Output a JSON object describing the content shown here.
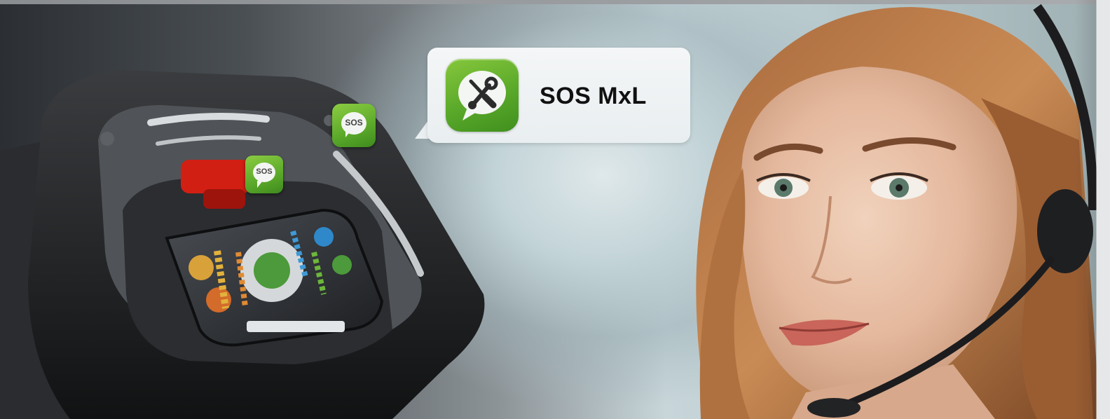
{
  "banner": {
    "bubble_title": "SOS MxL",
    "app_icon": "wrench-screwdriver-chat-icon",
    "badge_label": "SOS",
    "badge_icon": "sos-chat-icon",
    "colors": {
      "accent_green": "#5aa92a",
      "bubble_bg": "#eef2f3",
      "title_text": "#111111"
    }
  }
}
